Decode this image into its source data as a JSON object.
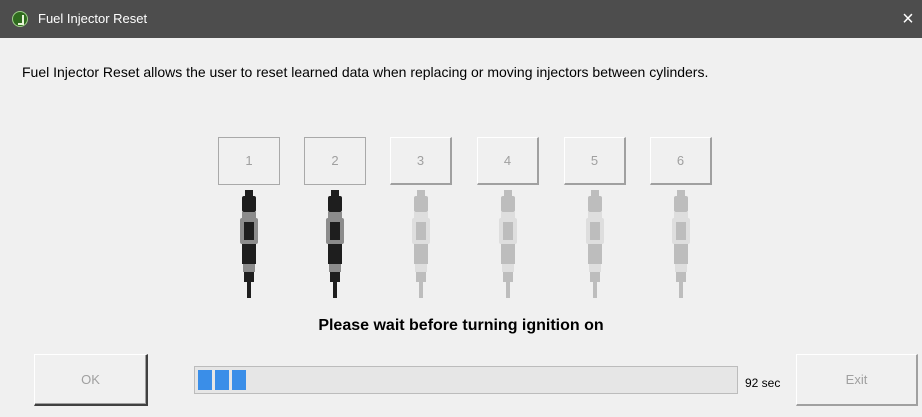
{
  "window": {
    "title": "Fuel Injector Reset",
    "close_glyph": "×"
  },
  "description": "Fuel Injector Reset allows the user to reset learned data when replacing or moving injectors between cylinders.",
  "cylinders": [
    {
      "label": "1",
      "state": "active"
    },
    {
      "label": "2",
      "state": "active"
    },
    {
      "label": "3",
      "state": "inactive"
    },
    {
      "label": "4",
      "state": "inactive"
    },
    {
      "label": "5",
      "state": "inactive"
    },
    {
      "label": "6",
      "state": "inactive"
    }
  ],
  "status_message": "Please wait before turning ignition on",
  "buttons": {
    "ok_label": "OK",
    "exit_label": "Exit"
  },
  "progress": {
    "filled_segments": 3,
    "text": "92 sec"
  },
  "colors": {
    "progress_fill": "#3a8ee8",
    "injector_active": "#1e1e1e",
    "injector_inactive": "#bdbdbd"
  }
}
